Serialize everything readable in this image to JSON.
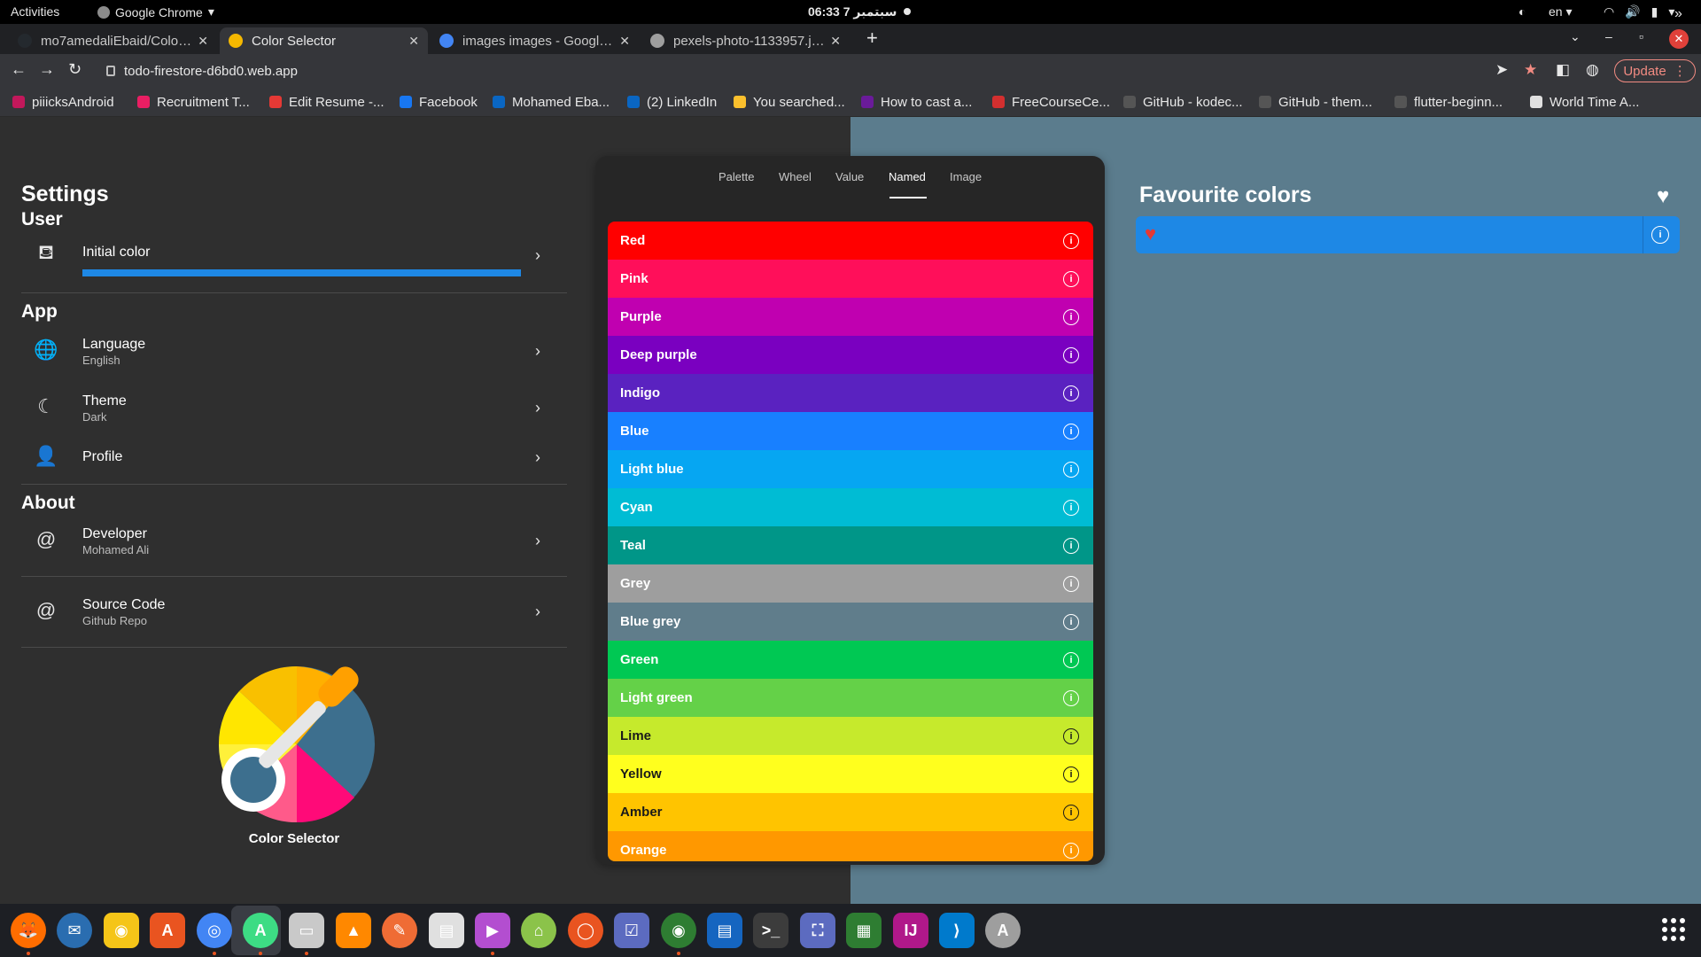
{
  "topbar": {
    "activities": "Activities",
    "app_name": "Google Chrome",
    "clock": "06:33  7 سبتمبر",
    "language": "en"
  },
  "tabs": [
    {
      "title": "mo7amedaliEbaid/Color-S",
      "color": "#24292e",
      "active": false
    },
    {
      "title": "Color Selector",
      "color": "#f5b800",
      "active": true
    },
    {
      "title": "images images - Google S",
      "color": "#4285f4",
      "active": false
    },
    {
      "title": "pexels-photo-1133957.jpe",
      "color": "#9e9e9e",
      "active": false
    }
  ],
  "address": {
    "url": "todo-firestore-d6bd0.web.app",
    "update_label": "Update"
  },
  "bookmarks": [
    {
      "label": "piiicksAndroid",
      "color": "#c2185b"
    },
    {
      "label": "Recruitment T...",
      "color": "#e91e63"
    },
    {
      "label": "Edit Resume -...",
      "color": "#e53935"
    },
    {
      "label": "Facebook",
      "color": "#1877f2"
    },
    {
      "label": "Mohamed Eba...",
      "color": "#0a66c2"
    },
    {
      "label": "(2) LinkedIn",
      "color": "#0a66c2"
    },
    {
      "label": "You searched...",
      "color": "#fbc02d"
    },
    {
      "label": "How to cast a...",
      "color": "#6a1b9a"
    },
    {
      "label": "FreeCourseCe...",
      "color": "#d32f2f"
    },
    {
      "label": "GitHub - kodec...",
      "color": "#555555"
    },
    {
      "label": "GitHub - them...",
      "color": "#555555"
    },
    {
      "label": "flutter-beginn...",
      "color": "#555555"
    },
    {
      "label": "World Time A...",
      "color": "#e0e0e0"
    }
  ],
  "settings": {
    "title": "Settings",
    "sections": {
      "user": "User",
      "app": "App",
      "about": "About"
    },
    "initial_color": {
      "label": "Initial color",
      "color": "#1e88e5"
    },
    "language": {
      "label": "Language",
      "value": "English"
    },
    "theme": {
      "label": "Theme",
      "value": "Dark"
    },
    "profile": {
      "label": "Profile"
    },
    "developer": {
      "label": "Developer",
      "value": "Mohamed Ali"
    },
    "source_code": {
      "label": "Source Code",
      "value": "Github Repo"
    },
    "logo_label": "Color Selector"
  },
  "picker": {
    "tabs": [
      "Palette",
      "Wheel",
      "Value",
      "Named",
      "Image"
    ],
    "selected_tab": "Named",
    "colors": [
      {
        "name": "Red",
        "bg": "#ff0000",
        "fg": "#ffffff"
      },
      {
        "name": "Pink",
        "bg": "#ff0f5a",
        "fg": "#ffffff"
      },
      {
        "name": "Purple",
        "bg": "#c000b0",
        "fg": "#ffffff"
      },
      {
        "name": "Deep purple",
        "bg": "#7a00c0",
        "fg": "#ffffff"
      },
      {
        "name": "Indigo",
        "bg": "#5a22c0",
        "fg": "#ffffff"
      },
      {
        "name": "Blue",
        "bg": "#1880ff",
        "fg": "#ffffff"
      },
      {
        "name": "Light blue",
        "bg": "#06a6f2",
        "fg": "#ffffff"
      },
      {
        "name": "Cyan",
        "bg": "#00bcd4",
        "fg": "#ffffff"
      },
      {
        "name": "Teal",
        "bg": "#009688",
        "fg": "#ffffff"
      },
      {
        "name": "Grey",
        "bg": "#9e9e9e",
        "fg": "#ffffff"
      },
      {
        "name": "Blue grey",
        "bg": "#607d8b",
        "fg": "#ffffff"
      },
      {
        "name": "Green",
        "bg": "#00c853",
        "fg": "#ffffff"
      },
      {
        "name": "Light green",
        "bg": "#64d148",
        "fg": "#ffffff"
      },
      {
        "name": "Lime",
        "bg": "#c6ea2c",
        "fg": "#1a1a1a"
      },
      {
        "name": "Yellow",
        "bg": "#ffff1e",
        "fg": "#1a1a1a"
      },
      {
        "name": "Amber",
        "bg": "#ffc400",
        "fg": "#1a1a1a"
      },
      {
        "name": "Orange",
        "bg": "#ff9800",
        "fg": "#ffffff"
      }
    ]
  },
  "favourites": {
    "title": "Favourite colors",
    "items": [
      {
        "color": "#1e88e5"
      }
    ]
  },
  "dock": {
    "items": [
      {
        "icon": "firefox-icon",
        "color": "#ff6d00",
        "glyph": "🦊",
        "round": true
      },
      {
        "icon": "thunderbird-icon",
        "color": "#2a6db0",
        "glyph": "✉",
        "round": true
      },
      {
        "icon": "rhythmbox-icon",
        "color": "#f5c518",
        "glyph": "◉",
        "round": false
      },
      {
        "icon": "software-center-icon",
        "color": "#e95420",
        "glyph": "A",
        "round": false
      },
      {
        "icon": "chrome-icon",
        "color": "#4285f4",
        "glyph": "◎",
        "round": true
      },
      {
        "icon": "android-studio-icon",
        "color": "#3ddc84",
        "glyph": "A",
        "round": true
      },
      {
        "icon": "files-icon",
        "color": "#c9c9c9",
        "glyph": "▭",
        "round": false
      },
      {
        "icon": "vlc-icon",
        "color": "#ff8800",
        "glyph": "▲",
        "round": false
      },
      {
        "icon": "inkscape-icon",
        "color": "#ef6c35",
        "glyph": "✎",
        "round": true
      },
      {
        "icon": "text-editor-icon",
        "color": "#e0e0e0",
        "glyph": "▤",
        "round": false
      },
      {
        "icon": "video-player-icon",
        "color": "#b34ed0",
        "glyph": "▶",
        "round": false
      },
      {
        "icon": "android-icon",
        "color": "#8bc34a",
        "glyph": "⌂",
        "round": true
      },
      {
        "icon": "ubuntu-icon",
        "color": "#e95420",
        "glyph": "◯",
        "round": true
      },
      {
        "icon": "tasks-icon",
        "color": "#5c6bc0",
        "glyph": "☑",
        "round": false
      },
      {
        "icon": "camera-icon",
        "color": "#2e7d32",
        "glyph": "◉",
        "round": true
      },
      {
        "icon": "document-viewer-icon",
        "color": "#1565c0",
        "glyph": "▤",
        "round": false
      },
      {
        "icon": "terminal-icon",
        "color": "#3c3c3c",
        "glyph": ">_",
        "round": false
      },
      {
        "icon": "screenshot-icon",
        "color": "#5c6bc0",
        "glyph": "⛶",
        "round": false
      },
      {
        "icon": "spreadsheet-icon",
        "color": "#2e7d32",
        "glyph": "▦",
        "round": false
      },
      {
        "icon": "intellij-icon",
        "color": "#b0188a",
        "glyph": "IJ",
        "round": false
      },
      {
        "icon": "vscode-icon",
        "color": "#007acc",
        "glyph": "⟩",
        "round": false
      },
      {
        "icon": "app-installer-icon",
        "color": "#9e9e9e",
        "glyph": "A",
        "round": true
      }
    ]
  }
}
